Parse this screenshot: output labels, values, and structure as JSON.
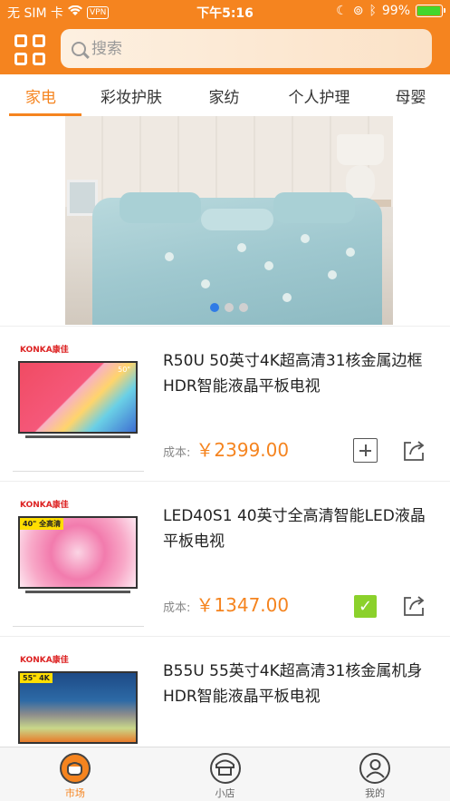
{
  "status_bar": {
    "carrier": "无 SIM 卡",
    "vpn": "VPN",
    "time": "下午5:16",
    "battery": "99%",
    "battery_level": 0.99
  },
  "header": {
    "menu_icon": "grid-icon",
    "search_placeholder": "搜索"
  },
  "tabs": [
    {
      "label": "家电",
      "active": true
    },
    {
      "label": "彩妆护肤"
    },
    {
      "label": "家纺"
    },
    {
      "label": "个人护理"
    },
    {
      "label": "母婴"
    }
  ],
  "banner": {
    "slide_count": 3,
    "active_slide": 1
  },
  "products": [
    {
      "brand": "KONKA康佳",
      "screen_badge": "50\"",
      "title": "R50U 50英寸4K超高清31核金属边框HDR智能液晶平板电视",
      "cost_label": "成本:",
      "price": "￥2399.00",
      "added": false
    },
    {
      "brand": "KONKA康佳",
      "screen_badge": "40\" 全高清",
      "title": "LED40S1 40英寸全高清智能LED液晶平板电视",
      "cost_label": "成本:",
      "price": "￥1347.00",
      "added": true
    },
    {
      "brand": "KONKA康佳",
      "screen_badge": "55\" 4K",
      "title": "B55U 55英寸4K超高清31核金属机身HDR智能液晶平板电视",
      "cost_label": "",
      "price": "",
      "added": false
    }
  ],
  "tab_bar": [
    {
      "label": "市场",
      "icon": "market-icon",
      "active": true
    },
    {
      "label": "小店",
      "icon": "shop-icon"
    },
    {
      "label": "我的",
      "icon": "profile-icon"
    }
  ],
  "colors": {
    "accent": "#f5841f",
    "checked": "#8bd12b",
    "dot_active": "#2f7be6"
  }
}
